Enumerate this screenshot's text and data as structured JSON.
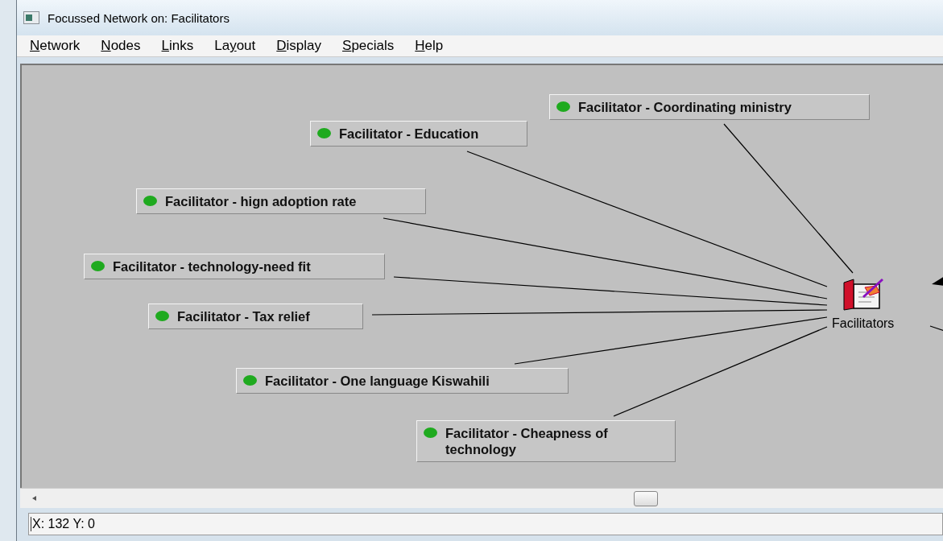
{
  "window": {
    "title": "Focussed Network on: Facilitators"
  },
  "menu": [
    {
      "key": "N",
      "post": "etwork"
    },
    {
      "key": "N",
      "post": "odes"
    },
    {
      "key": "L",
      "post": "inks"
    },
    {
      "pre": "La",
      "key": "y",
      "post": "out"
    },
    {
      "key": "D",
      "post": "isplay"
    },
    {
      "key": "S",
      "post": "pecials"
    },
    {
      "key": "H",
      "post": "elp"
    }
  ],
  "network": {
    "center": {
      "label": "Facilitators"
    },
    "nodes": [
      {
        "label": "Facilitator - Coordinating ministry",
        "color": "#1faa1f"
      },
      {
        "label": "Facilitator - Education",
        "color": "#1faa1f"
      },
      {
        "label": "Facilitator - hign adoption rate",
        "color": "#1faa1f"
      },
      {
        "label": "Facilitator - technology-need fit",
        "color": "#1faa1f"
      },
      {
        "label": "Facilitator - Tax relief",
        "color": "#1faa1f"
      },
      {
        "label": "Facilitator - One language Kiswahili",
        "color": "#1faa1f"
      },
      {
        "label": "Facilitator - Cheapness of technology",
        "color": "#1faa1f"
      }
    ]
  },
  "status_bar": {
    "text": "X: 132 Y: 0"
  }
}
